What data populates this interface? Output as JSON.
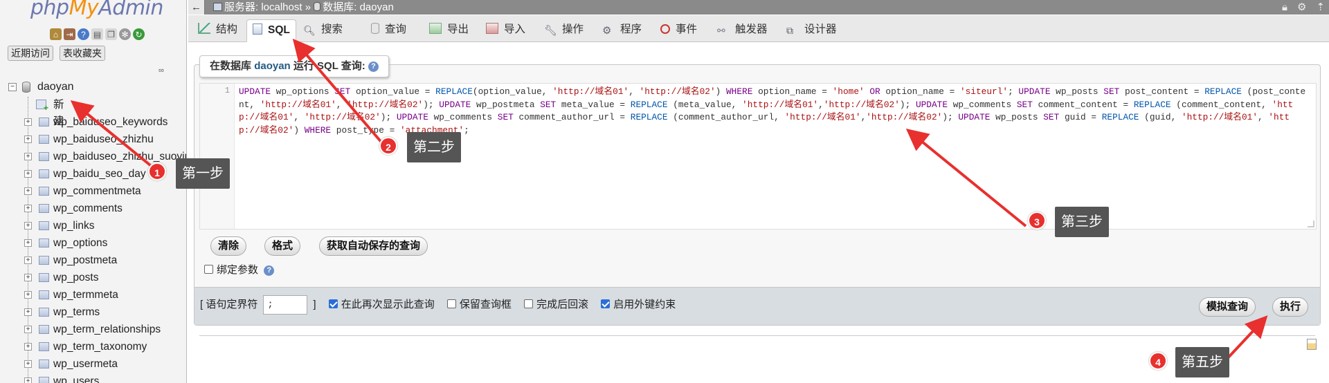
{
  "app": {
    "logo_php": "php",
    "logo_my": "My",
    "logo_admin": "Admin"
  },
  "sidebar": {
    "recent_label": "近期访问",
    "favorites_label": "表收藏夹",
    "collapse_link": "∞",
    "database": "daoyan",
    "new_label": "新建",
    "tables": [
      "wp_baiduseo_keywords",
      "wp_baiduseo_zhizhu",
      "wp_baiduseo_zhizhu_suoyin",
      "wp_baidu_seo_day",
      "wp_commentmeta",
      "wp_comments",
      "wp_links",
      "wp_options",
      "wp_postmeta",
      "wp_posts",
      "wp_termmeta",
      "wp_terms",
      "wp_term_relationships",
      "wp_term_taxonomy",
      "wp_usermeta",
      "wp_users"
    ]
  },
  "topbar": {
    "back": "←",
    "server_label": "服务器: localhost",
    "separator": "»",
    "database_label": "数据库: daoyan"
  },
  "tabs": [
    {
      "label": "结构"
    },
    {
      "label": "SQL"
    },
    {
      "label": "搜索"
    },
    {
      "label": "查询"
    },
    {
      "label": "导出"
    },
    {
      "label": "导入"
    },
    {
      "label": "操作"
    },
    {
      "label": "程序"
    },
    {
      "label": "事件"
    },
    {
      "label": "触发器"
    },
    {
      "label": "设计器"
    }
  ],
  "query_panel": {
    "title_prefix": "在数据库",
    "title_db": "daoyan",
    "title_suffix": "运行 SQL 查询:",
    "line_number": "1",
    "sql": "UPDATE wp_options SET option_value = REPLACE(option_value, 'http://域名01', 'http://域名02') WHERE option_name = 'home' OR option_name = 'siteurl'; UPDATE wp_posts SET post_content = REPLACE (post_content, 'http://域名01', 'http://域名02'); UPDATE wp_postmeta SET meta_value = REPLACE (meta_value, 'http://域名01','http://域名02'); UPDATE wp_comments SET comment_content = REPLACE (comment_content, 'http://域名01', 'http://域名02'); UPDATE wp_comments SET comment_author_url = REPLACE (comment_author_url, 'http://域名01','http://域名02'); UPDATE wp_posts SET guid = REPLACE (guid, 'http://域名01', 'http://域名02') WHERE post_type = 'attachment';",
    "clear_button": "清除",
    "format_button": "格式",
    "autosave_button": "获取自动保存的查询",
    "bind_params_label": "绑定参数"
  },
  "options": {
    "delimiter_label_open": "[ 语句定界符",
    "delimiter_value": ";",
    "delimiter_label_close": "]",
    "show_again_label": "在此再次显示此查询",
    "show_again_checked": true,
    "keep_box_label": "保留查询框",
    "keep_box_checked": false,
    "rollback_label": "完成后回滚",
    "rollback_checked": false,
    "foreign_keys_label": "启用外键约束",
    "foreign_keys_checked": true,
    "simulate_button": "模拟查询",
    "execute_button": "执行"
  },
  "annotations": [
    {
      "number": "1",
      "text": "第一步"
    },
    {
      "number": "2",
      "text": "第二步"
    },
    {
      "number": "3",
      "text": "第三步"
    },
    {
      "number": "4",
      "text": "第五步"
    }
  ],
  "colors": {
    "annotation_red": "#e8302e",
    "callout_bg": "#555555",
    "link_blue": "#235a81"
  }
}
